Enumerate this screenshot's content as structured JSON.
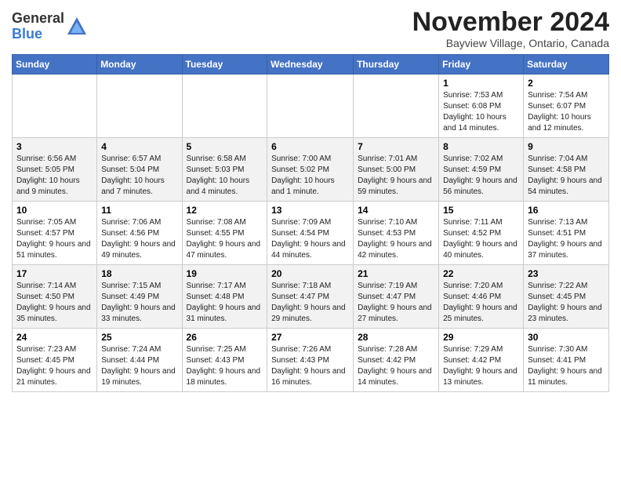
{
  "header": {
    "logo_line1": "General",
    "logo_line2": "Blue",
    "month": "November 2024",
    "location": "Bayview Village, Ontario, Canada"
  },
  "weekdays": [
    "Sunday",
    "Monday",
    "Tuesday",
    "Wednesday",
    "Thursday",
    "Friday",
    "Saturday"
  ],
  "weeks": [
    [
      {
        "day": "",
        "info": ""
      },
      {
        "day": "",
        "info": ""
      },
      {
        "day": "",
        "info": ""
      },
      {
        "day": "",
        "info": ""
      },
      {
        "day": "",
        "info": ""
      },
      {
        "day": "1",
        "info": "Sunrise: 7:53 AM\nSunset: 6:08 PM\nDaylight: 10 hours and 14 minutes."
      },
      {
        "day": "2",
        "info": "Sunrise: 7:54 AM\nSunset: 6:07 PM\nDaylight: 10 hours and 12 minutes."
      }
    ],
    [
      {
        "day": "3",
        "info": "Sunrise: 6:56 AM\nSunset: 5:05 PM\nDaylight: 10 hours and 9 minutes."
      },
      {
        "day": "4",
        "info": "Sunrise: 6:57 AM\nSunset: 5:04 PM\nDaylight: 10 hours and 7 minutes."
      },
      {
        "day": "5",
        "info": "Sunrise: 6:58 AM\nSunset: 5:03 PM\nDaylight: 10 hours and 4 minutes."
      },
      {
        "day": "6",
        "info": "Sunrise: 7:00 AM\nSunset: 5:02 PM\nDaylight: 10 hours and 1 minute."
      },
      {
        "day": "7",
        "info": "Sunrise: 7:01 AM\nSunset: 5:00 PM\nDaylight: 9 hours and 59 minutes."
      },
      {
        "day": "8",
        "info": "Sunrise: 7:02 AM\nSunset: 4:59 PM\nDaylight: 9 hours and 56 minutes."
      },
      {
        "day": "9",
        "info": "Sunrise: 7:04 AM\nSunset: 4:58 PM\nDaylight: 9 hours and 54 minutes."
      }
    ],
    [
      {
        "day": "10",
        "info": "Sunrise: 7:05 AM\nSunset: 4:57 PM\nDaylight: 9 hours and 51 minutes."
      },
      {
        "day": "11",
        "info": "Sunrise: 7:06 AM\nSunset: 4:56 PM\nDaylight: 9 hours and 49 minutes."
      },
      {
        "day": "12",
        "info": "Sunrise: 7:08 AM\nSunset: 4:55 PM\nDaylight: 9 hours and 47 minutes."
      },
      {
        "day": "13",
        "info": "Sunrise: 7:09 AM\nSunset: 4:54 PM\nDaylight: 9 hours and 44 minutes."
      },
      {
        "day": "14",
        "info": "Sunrise: 7:10 AM\nSunset: 4:53 PM\nDaylight: 9 hours and 42 minutes."
      },
      {
        "day": "15",
        "info": "Sunrise: 7:11 AM\nSunset: 4:52 PM\nDaylight: 9 hours and 40 minutes."
      },
      {
        "day": "16",
        "info": "Sunrise: 7:13 AM\nSunset: 4:51 PM\nDaylight: 9 hours and 37 minutes."
      }
    ],
    [
      {
        "day": "17",
        "info": "Sunrise: 7:14 AM\nSunset: 4:50 PM\nDaylight: 9 hours and 35 minutes."
      },
      {
        "day": "18",
        "info": "Sunrise: 7:15 AM\nSunset: 4:49 PM\nDaylight: 9 hours and 33 minutes."
      },
      {
        "day": "19",
        "info": "Sunrise: 7:17 AM\nSunset: 4:48 PM\nDaylight: 9 hours and 31 minutes."
      },
      {
        "day": "20",
        "info": "Sunrise: 7:18 AM\nSunset: 4:47 PM\nDaylight: 9 hours and 29 minutes."
      },
      {
        "day": "21",
        "info": "Sunrise: 7:19 AM\nSunset: 4:47 PM\nDaylight: 9 hours and 27 minutes."
      },
      {
        "day": "22",
        "info": "Sunrise: 7:20 AM\nSunset: 4:46 PM\nDaylight: 9 hours and 25 minutes."
      },
      {
        "day": "23",
        "info": "Sunrise: 7:22 AM\nSunset: 4:45 PM\nDaylight: 9 hours and 23 minutes."
      }
    ],
    [
      {
        "day": "24",
        "info": "Sunrise: 7:23 AM\nSunset: 4:45 PM\nDaylight: 9 hours and 21 minutes."
      },
      {
        "day": "25",
        "info": "Sunrise: 7:24 AM\nSunset: 4:44 PM\nDaylight: 9 hours and 19 minutes."
      },
      {
        "day": "26",
        "info": "Sunrise: 7:25 AM\nSunset: 4:43 PM\nDaylight: 9 hours and 18 minutes."
      },
      {
        "day": "27",
        "info": "Sunrise: 7:26 AM\nSunset: 4:43 PM\nDaylight: 9 hours and 16 minutes."
      },
      {
        "day": "28",
        "info": "Sunrise: 7:28 AM\nSunset: 4:42 PM\nDaylight: 9 hours and 14 minutes."
      },
      {
        "day": "29",
        "info": "Sunrise: 7:29 AM\nSunset: 4:42 PM\nDaylight: 9 hours and 13 minutes."
      },
      {
        "day": "30",
        "info": "Sunrise: 7:30 AM\nSunset: 4:41 PM\nDaylight: 9 hours and 11 minutes."
      }
    ]
  ]
}
